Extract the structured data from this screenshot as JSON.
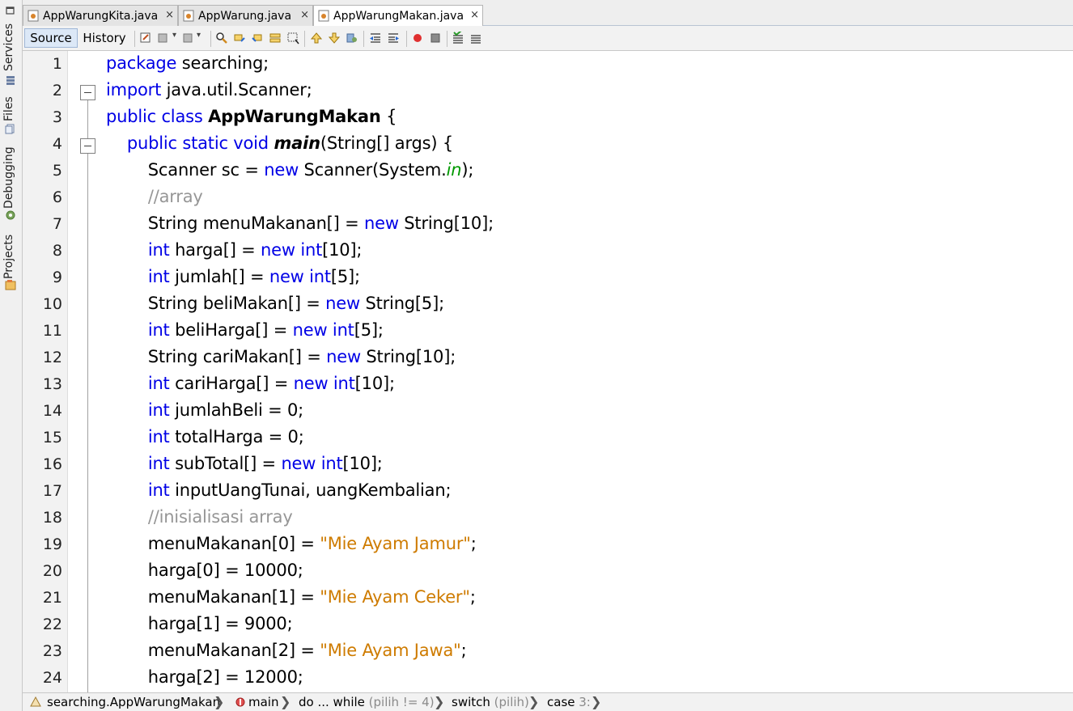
{
  "side_strip": {
    "tabs": [
      {
        "label": "Services",
        "icon": "services-icon"
      },
      {
        "label": "Files",
        "icon": "files-icon"
      },
      {
        "label": "Debugging",
        "icon": "debugging-icon"
      },
      {
        "label": "Projects",
        "icon": "projects-icon"
      }
    ]
  },
  "tabs": [
    {
      "label": "AppWarungKita.java",
      "close": "×",
      "active": false
    },
    {
      "label": "AppWarung.java",
      "close": "×",
      "active": false
    },
    {
      "label": "AppWarungMakan.java",
      "close": "×",
      "active": true
    }
  ],
  "toolbar": {
    "source_label": "Source",
    "history_label": "History"
  },
  "editor": {
    "lines": [
      {
        "no": "1",
        "tokens": [
          {
            "t": "package",
            "c": "kw"
          },
          {
            "t": " searching;",
            "c": "plain"
          }
        ]
      },
      {
        "no": "2",
        "tokens": [
          {
            "t": "import",
            "c": "kw"
          },
          {
            "t": " java.util.Scanner;",
            "c": "plain"
          }
        ]
      },
      {
        "no": "3",
        "tokens": [
          {
            "t": "public class",
            "c": "kw"
          },
          {
            "t": " ",
            "c": "plain"
          },
          {
            "t": "AppWarungMakan",
            "c": "cls"
          },
          {
            "t": " {",
            "c": "plain"
          }
        ]
      },
      {
        "no": "4",
        "tokens": [
          {
            "t": "    ",
            "c": "plain"
          },
          {
            "t": "public static void",
            "c": "kw"
          },
          {
            "t": " ",
            "c": "plain"
          },
          {
            "t": "main",
            "c": "mth"
          },
          {
            "t": "(String[] args) {",
            "c": "plain"
          }
        ]
      },
      {
        "no": "5",
        "tokens": [
          {
            "t": "        Scanner sc = ",
            "c": "plain"
          },
          {
            "t": "new",
            "c": "kw"
          },
          {
            "t": " Scanner(System.",
            "c": "plain"
          },
          {
            "t": "in",
            "c": "fld"
          },
          {
            "t": ");",
            "c": "plain"
          }
        ]
      },
      {
        "no": "6",
        "tokens": [
          {
            "t": "        ",
            "c": "plain"
          },
          {
            "t": "//array",
            "c": "cm"
          }
        ]
      },
      {
        "no": "7",
        "tokens": [
          {
            "t": "        String menuMakanan[] = ",
            "c": "plain"
          },
          {
            "t": "new",
            "c": "kw"
          },
          {
            "t": " String[10];",
            "c": "plain"
          }
        ]
      },
      {
        "no": "8",
        "tokens": [
          {
            "t": "        ",
            "c": "plain"
          },
          {
            "t": "int",
            "c": "kw"
          },
          {
            "t": " harga[] = ",
            "c": "plain"
          },
          {
            "t": "new int",
            "c": "kw"
          },
          {
            "t": "[10];",
            "c": "plain"
          }
        ]
      },
      {
        "no": "9",
        "tokens": [
          {
            "t": "        ",
            "c": "plain"
          },
          {
            "t": "int",
            "c": "kw"
          },
          {
            "t": " jumlah[] = ",
            "c": "plain"
          },
          {
            "t": "new int",
            "c": "kw"
          },
          {
            "t": "[5];",
            "c": "plain"
          }
        ]
      },
      {
        "no": "10",
        "tokens": [
          {
            "t": "        String beliMakan[] = ",
            "c": "plain"
          },
          {
            "t": "new",
            "c": "kw"
          },
          {
            "t": " String[5];",
            "c": "plain"
          }
        ]
      },
      {
        "no": "11",
        "tokens": [
          {
            "t": "        ",
            "c": "plain"
          },
          {
            "t": "int",
            "c": "kw"
          },
          {
            "t": " beliHarga[] = ",
            "c": "plain"
          },
          {
            "t": "new int",
            "c": "kw"
          },
          {
            "t": "[5];",
            "c": "plain"
          }
        ]
      },
      {
        "no": "12",
        "tokens": [
          {
            "t": "        String cariMakan[] = ",
            "c": "plain"
          },
          {
            "t": "new",
            "c": "kw"
          },
          {
            "t": " String[10];",
            "c": "plain"
          }
        ]
      },
      {
        "no": "13",
        "tokens": [
          {
            "t": "        ",
            "c": "plain"
          },
          {
            "t": "int",
            "c": "kw"
          },
          {
            "t": " cariHarga[] = ",
            "c": "plain"
          },
          {
            "t": "new int",
            "c": "kw"
          },
          {
            "t": "[10];",
            "c": "plain"
          }
        ]
      },
      {
        "no": "14",
        "tokens": [
          {
            "t": "        ",
            "c": "plain"
          },
          {
            "t": "int",
            "c": "kw"
          },
          {
            "t": " jumlahBeli = 0;",
            "c": "plain"
          }
        ]
      },
      {
        "no": "15",
        "tokens": [
          {
            "t": "        ",
            "c": "plain"
          },
          {
            "t": "int",
            "c": "kw"
          },
          {
            "t": " totalHarga = 0;",
            "c": "plain"
          }
        ]
      },
      {
        "no": "16",
        "tokens": [
          {
            "t": "        ",
            "c": "plain"
          },
          {
            "t": "int",
            "c": "kw"
          },
          {
            "t": " subTotal[] = ",
            "c": "plain"
          },
          {
            "t": "new int",
            "c": "kw"
          },
          {
            "t": "[10];",
            "c": "plain"
          }
        ]
      },
      {
        "no": "17",
        "tokens": [
          {
            "t": "        ",
            "c": "plain"
          },
          {
            "t": "int",
            "c": "kw"
          },
          {
            "t": " inputUangTunai, uangKembalian;",
            "c": "plain"
          }
        ]
      },
      {
        "no": "18",
        "tokens": [
          {
            "t": "        ",
            "c": "plain"
          },
          {
            "t": "//inisialisasi array",
            "c": "cm"
          }
        ]
      },
      {
        "no": "19",
        "tokens": [
          {
            "t": "        menuMakanan[0] = ",
            "c": "plain"
          },
          {
            "t": "\"Mie Ayam Jamur\"",
            "c": "str"
          },
          {
            "t": ";",
            "c": "plain"
          }
        ]
      },
      {
        "no": "20",
        "tokens": [
          {
            "t": "        harga[0] = 10000;",
            "c": "plain"
          }
        ]
      },
      {
        "no": "21",
        "tokens": [
          {
            "t": "        menuMakanan[1] = ",
            "c": "plain"
          },
          {
            "t": "\"Mie Ayam Ceker\"",
            "c": "str"
          },
          {
            "t": ";",
            "c": "plain"
          }
        ]
      },
      {
        "no": "22",
        "tokens": [
          {
            "t": "        harga[1] = 9000;",
            "c": "plain"
          }
        ]
      },
      {
        "no": "23",
        "tokens": [
          {
            "t": "        menuMakanan[2] = ",
            "c": "plain"
          },
          {
            "t": "\"Mie Ayam Jawa\"",
            "c": "str"
          },
          {
            "t": ";",
            "c": "plain"
          }
        ]
      },
      {
        "no": "24",
        "tokens": [
          {
            "t": "        harga[2] = 12000;",
            "c": "plain"
          }
        ]
      }
    ],
    "fold_markers": [
      "2",
      "4"
    ]
  },
  "breadcrumb": {
    "items": [
      {
        "text": "searching.AppWarungMakan",
        "dim": "",
        "icon": "class-icon"
      },
      {
        "text": "main",
        "dim": "",
        "icon": "method-icon"
      },
      {
        "text": "do ... while ",
        "dim": "(pilih != 4)",
        "icon": ""
      },
      {
        "text": "switch ",
        "dim": "(pilih)",
        "icon": ""
      },
      {
        "text": "case ",
        "dim": "3:",
        "icon": ""
      }
    ],
    "separator": "❯"
  },
  "colors": {
    "keyword": "#0000e6",
    "comment": "#969696",
    "string": "#ce7b00",
    "field": "#009900"
  }
}
